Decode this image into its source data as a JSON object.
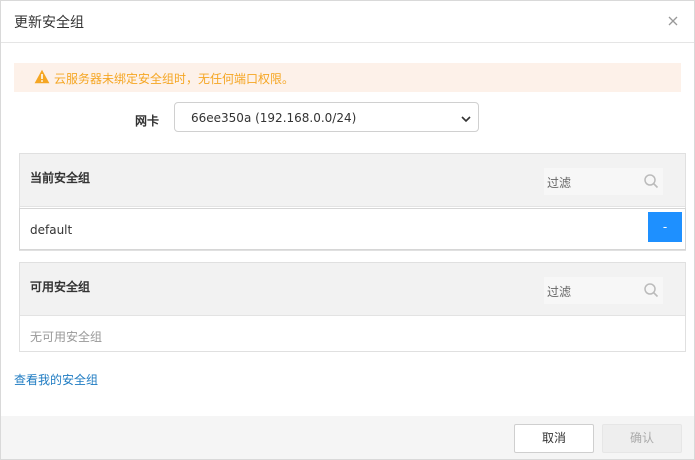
{
  "dialog": {
    "title": "更新安全组"
  },
  "warning": {
    "text": "云服务器未绑定安全组时，无任何端口权限。",
    "color": "#f5a623"
  },
  "nic": {
    "label": "网卡",
    "selected": "66ee350a (192.168.0.0/24)"
  },
  "current": {
    "title": "当前安全组",
    "filter_placeholder": "过滤",
    "items": [
      {
        "name": "default",
        "action_label": "-"
      }
    ]
  },
  "available": {
    "title": "可用安全组",
    "filter_placeholder": "过滤",
    "empty_text": "无可用安全组"
  },
  "link": {
    "text": "查看我的安全组"
  },
  "footer": {
    "cancel_label": "取消",
    "ok_label": "确认"
  },
  "colors": {
    "accent": "#1e90ff",
    "link": "#1e7bc2"
  }
}
